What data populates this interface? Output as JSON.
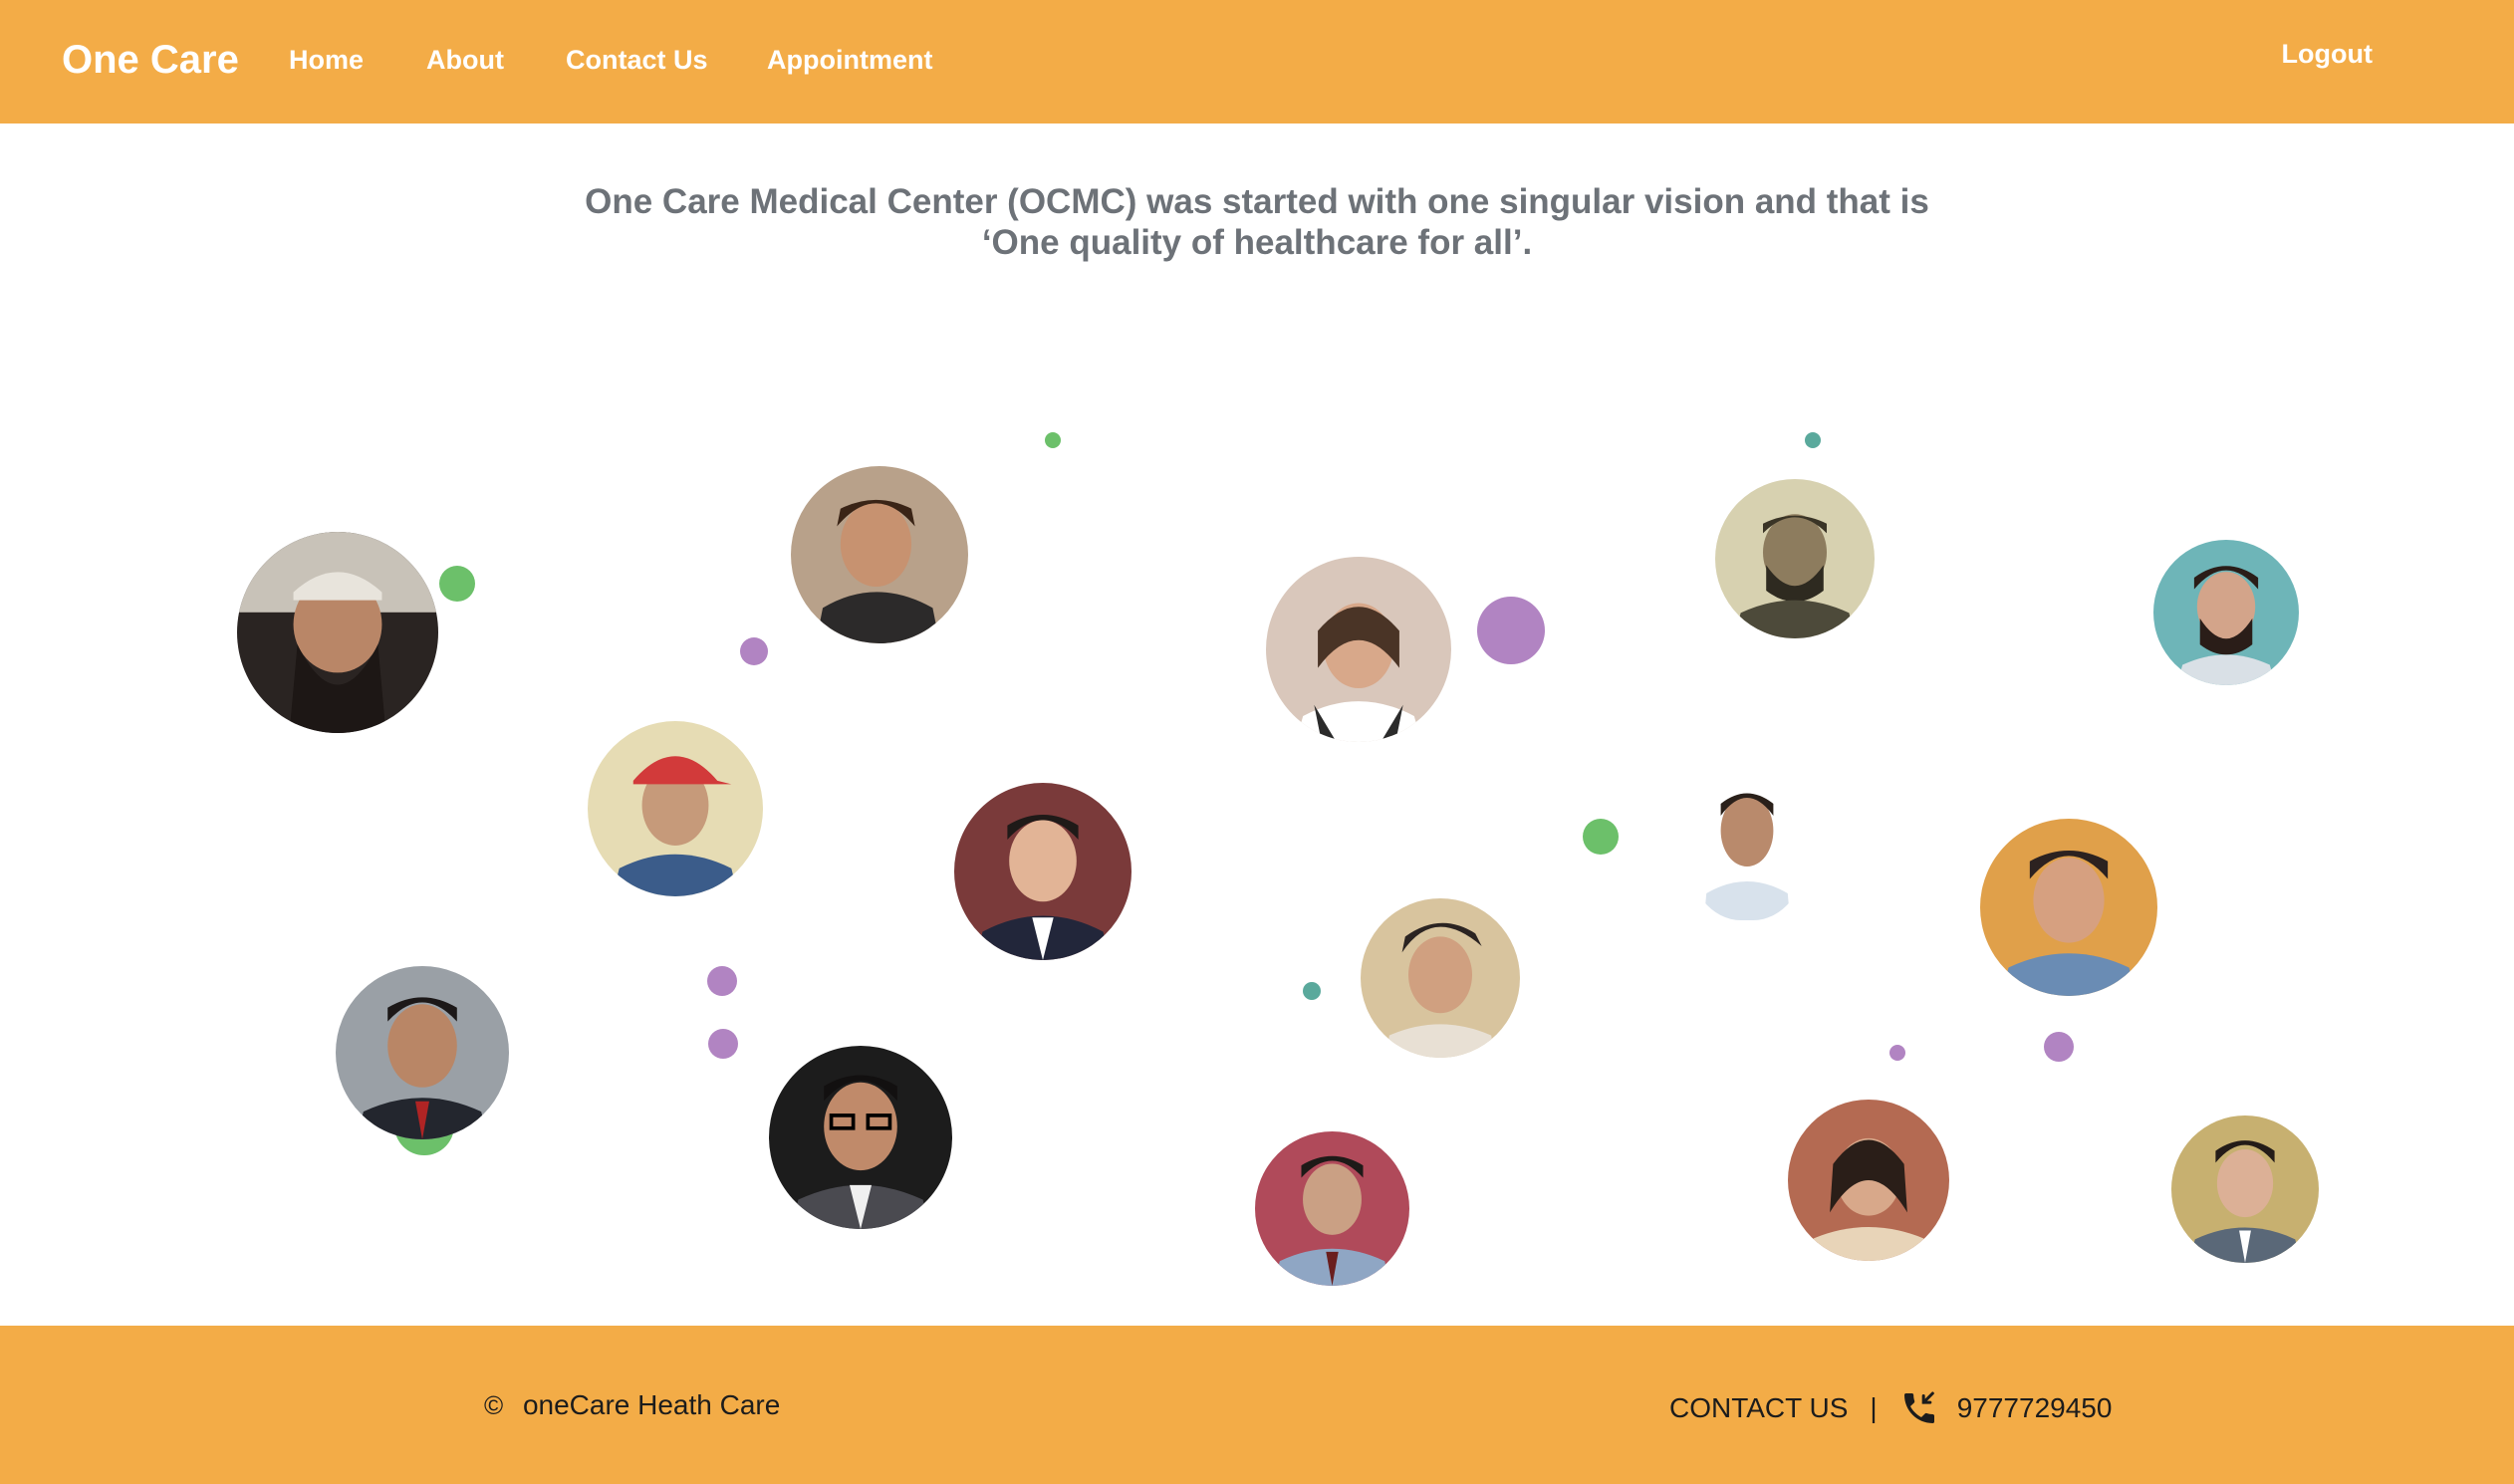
{
  "header": {
    "brand": "One Care",
    "nav": [
      {
        "label": "Home"
      },
      {
        "label": "About"
      },
      {
        "label": "Contact Us"
      },
      {
        "label": "Appointment"
      }
    ],
    "logout": "Logout"
  },
  "intro": {
    "line1": "One Care Medical Center (OCMC) was started with one singular vision and that is",
    "line2": "‘One quality of healthcare for all’."
  },
  "team": {
    "avatar_icon": "person-photo-icon",
    "count": 17
  },
  "footer": {
    "copyright_symbol": "©",
    "copyright_text": "oneCare Heath Care",
    "contact_label": "CONTACT US",
    "separator": "|",
    "phone_icon": "phone-incoming-icon",
    "phone": "9777729450"
  },
  "colors": {
    "accent": "#f3ac47",
    "intro_text": "#6d7278",
    "green_dot": "#6cc06a",
    "teal_dot": "#5aa99c",
    "purple_dot": "#b184c2"
  }
}
